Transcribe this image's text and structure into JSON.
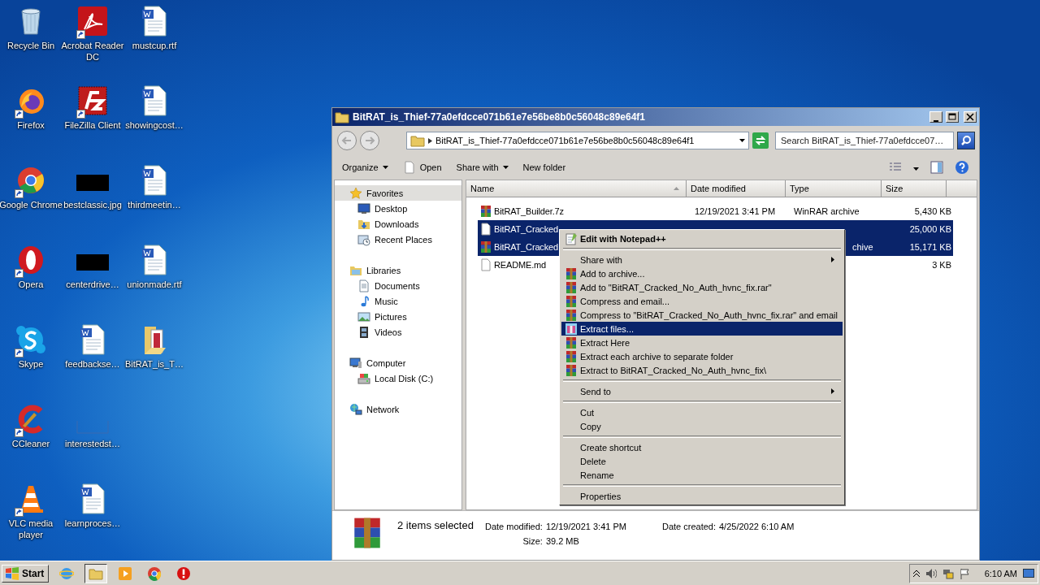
{
  "desktop": {
    "icons": [
      {
        "label": "Recycle Bin",
        "kind": "bin",
        "shortcut": false
      },
      {
        "label": "Firefox",
        "kind": "fox",
        "shortcut": true
      },
      {
        "label": "Google Chrome",
        "kind": "ring",
        "shortcut": true
      },
      {
        "label": "Opera",
        "kind": "opera",
        "shortcut": true
      },
      {
        "label": "Skype",
        "kind": "cloud",
        "shortcut": true
      },
      {
        "label": "CCleaner",
        "kind": "arc",
        "shortcut": true
      },
      {
        "label": "VLC media player",
        "kind": "cone",
        "shortcut": true
      },
      {
        "label": "Acrobat Reader DC",
        "kind": "pdf",
        "shortcut": true
      },
      {
        "label": "FileZilla Client",
        "kind": "fz",
        "shortcut": true
      },
      {
        "label": "bestclassic.jpg",
        "kind": "black",
        "shortcut": false
      },
      {
        "label": "centerdrive…",
        "kind": "black",
        "shortcut": false
      },
      {
        "label": "feedbackse…",
        "kind": "doc",
        "shortcut": false
      },
      {
        "label": "interestedst…",
        "kind": "blank",
        "shortcut": false
      },
      {
        "label": "learnproces…",
        "kind": "doc",
        "shortcut": false
      },
      {
        "label": "mustcup.rtf",
        "kind": "doc",
        "shortcut": false
      },
      {
        "label": "showingcost…",
        "kind": "doc",
        "shortcut": false
      },
      {
        "label": "thirdmeetin…",
        "kind": "doc",
        "shortcut": false
      },
      {
        "label": "unionmade.rtf",
        "kind": "doc",
        "shortcut": false
      },
      {
        "label": "BitRAT_is_T…",
        "kind": "folder",
        "shortcut": false
      }
    ]
  },
  "explorer": {
    "title": "BitRAT_is_Thief-77a0efdcce071b61e7e56be8b0c56048c89e64f1",
    "address": "BitRAT_is_Thief-77a0efdcce071b61e7e56be8b0c56048c89e64f1",
    "search": {
      "placeholder": "Search BitRAT_is_Thief-77a0efdcce07…"
    },
    "toolbar": [
      {
        "label": "Organize",
        "kind": "menu"
      },
      {
        "label": "Open",
        "kind": "open"
      },
      {
        "label": "Share with",
        "kind": "menu"
      },
      {
        "label": "New folder",
        "kind": "plain"
      }
    ],
    "nav": [
      {
        "label": "Favorites",
        "kind": "star",
        "selected": true,
        "children": [
          {
            "label": "Desktop",
            "kind": "desktop",
            "selected": false
          },
          {
            "label": "Downloads",
            "kind": "downloads",
            "selected": false
          },
          {
            "label": "Recent Places",
            "kind": "recent",
            "selected": false
          }
        ]
      },
      {
        "label": "Libraries",
        "kind": "library",
        "selected": false,
        "children": [
          {
            "label": "Documents",
            "kind": "documents",
            "selected": false
          },
          {
            "label": "Music",
            "kind": "music",
            "selected": false
          },
          {
            "label": "Pictures",
            "kind": "pictures",
            "selected": false
          },
          {
            "label": "Videos",
            "kind": "videos",
            "selected": false
          }
        ]
      },
      {
        "label": "Computer",
        "kind": "computer",
        "selected": false,
        "children": [
          {
            "label": "Local Disk (C:)",
            "kind": "disk",
            "selected": false
          }
        ]
      },
      {
        "label": "Network",
        "kind": "network",
        "selected": false
      }
    ],
    "table": {
      "columns": [
        {
          "label": "Name",
          "sorted": true
        },
        {
          "label": "Date modified",
          "sorted": false
        },
        {
          "label": "Type",
          "sorted": false
        },
        {
          "label": "Size",
          "sorted": false
        }
      ],
      "rows": [
        {
          "name": "BitRAT_Builder.7z",
          "date": "12/19/2021 3:41 PM",
          "type": "WinRAR archive",
          "size": "5,430 KB",
          "kind": "archive",
          "selected": false
        },
        {
          "name": "BitRAT_Cracked",
          "size": "25,000 KB",
          "kind": "file",
          "selected": true
        },
        {
          "name": "BitRAT_Cracked",
          "type": "chive",
          "size": "15,171 KB",
          "kind": "archive",
          "selected": true
        },
        {
          "name": "README.md",
          "size": "3 KB",
          "kind": "file",
          "selected": false
        }
      ]
    },
    "details": {
      "summary": "2 items selected",
      "fields": [
        {
          "label": "Date modified:",
          "value": "12/19/2021 3:41 PM"
        },
        {
          "label": "Date created:",
          "value": "4/25/2022 6:10 AM"
        },
        {
          "label": "Size:",
          "value": "39.2 MB"
        }
      ]
    }
  },
  "context_menu": {
    "items": [
      {
        "label": "Edit with Notepad++",
        "kind": "default",
        "selected": false
      },
      {
        "kind": "separator"
      },
      {
        "label": "Share with",
        "kind": "submenu",
        "selected": false
      },
      {
        "label": "Add to archive...",
        "kind": "archive",
        "selected": false
      },
      {
        "label": "Add to \"BitRAT_Cracked_No_Auth_hvnc_fix.rar\"",
        "kind": "archive",
        "selected": false
      },
      {
        "label": "Compress and email...",
        "kind": "archive",
        "selected": false
      },
      {
        "label": "Compress to \"BitRAT_Cracked_No_Auth_hvnc_fix.rar\" and email",
        "kind": "archive",
        "selected": false
      },
      {
        "label": "Extract files...",
        "kind": "extract",
        "selected": true
      },
      {
        "label": "Extract Here",
        "kind": "archive",
        "selected": false
      },
      {
        "label": "Extract each archive to separate folder",
        "kind": "archive",
        "selected": false
      },
      {
        "label": "Extract to BitRAT_Cracked_No_Auth_hvnc_fix\\",
        "kind": "archive",
        "selected": false
      },
      {
        "kind": "separator"
      },
      {
        "label": "Send to",
        "kind": "submenu",
        "selected": false
      },
      {
        "kind": "separator"
      },
      {
        "label": "Cut",
        "kind": "plain",
        "selected": false
      },
      {
        "label": "Copy",
        "kind": "plain",
        "selected": false
      },
      {
        "kind": "separator"
      },
      {
        "label": "Create shortcut",
        "kind": "plain",
        "selected": false
      },
      {
        "label": "Delete",
        "kind": "plain",
        "selected": false
      },
      {
        "label": "Rename",
        "kind": "plain",
        "selected": false
      },
      {
        "kind": "separator"
      },
      {
        "label": "Properties",
        "kind": "plain",
        "selected": false
      }
    ]
  },
  "taskbar": {
    "start": "Start",
    "apps": [
      {
        "kind": "ie",
        "selected": false
      },
      {
        "kind": "explorer",
        "selected": true
      },
      {
        "kind": "media",
        "selected": false
      },
      {
        "kind": "ring",
        "selected": false
      },
      {
        "kind": "stop",
        "selected": false
      }
    ],
    "clock": "6:10 AM"
  }
}
